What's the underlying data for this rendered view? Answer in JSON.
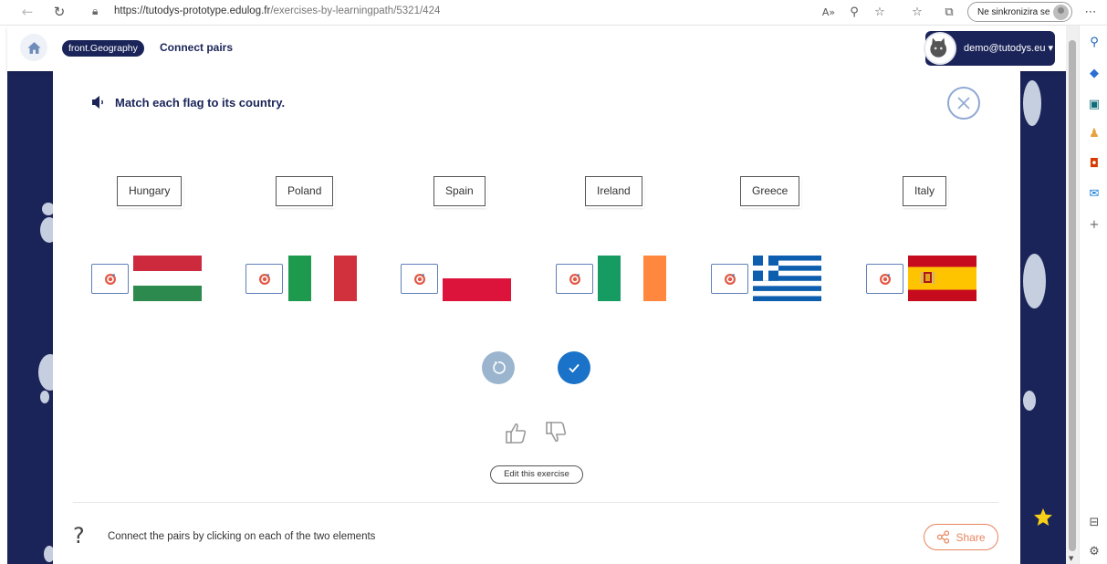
{
  "browser": {
    "url_host": "https://tutodys-prototype.edulog.fr",
    "url_path": "/exercises-by-learningpath/5321/424",
    "sync_label": "Ne sinkronizira se"
  },
  "header": {
    "subject": "front.Geography",
    "title": "Connect pairs",
    "user_email": "demo@tutodys.eu"
  },
  "exercise": {
    "instruction": "Match each flag to its country.",
    "countries": [
      "Hungary",
      "Poland",
      "Spain",
      "Ireland",
      "Greece",
      "Italy"
    ],
    "flags": [
      "hungary-flag",
      "italy-flag",
      "poland-flag",
      "ireland-flag",
      "greece-flag",
      "spain-flag"
    ],
    "edit_label": "Edit this exercise"
  },
  "footer": {
    "help_symbol": "?",
    "help_text": "Connect the pairs by clicking on each of the two elements",
    "share_label": "Share"
  },
  "colors": {
    "navy": "#1b2459",
    "accent_blue": "#1a73c8",
    "share_orange": "#e8845f",
    "target_border": "#5f7fb8"
  }
}
